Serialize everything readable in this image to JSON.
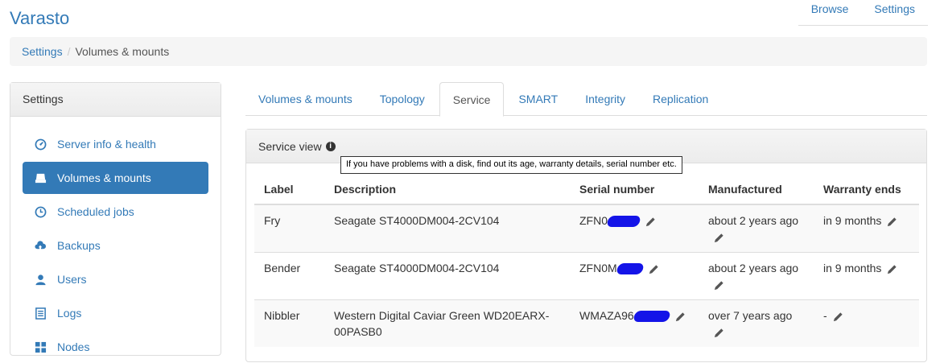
{
  "app": {
    "title": "Varasto"
  },
  "topnav": {
    "items": [
      "Browse",
      "Settings"
    ]
  },
  "breadcrumb": {
    "items": [
      "Settings",
      "Volumes & mounts"
    ]
  },
  "sidebar": {
    "title": "Settings",
    "items": [
      {
        "label": "Server info & health",
        "icon": "dashboard-icon"
      },
      {
        "label": "Volumes & mounts",
        "icon": "hdd-icon",
        "active": true
      },
      {
        "label": "Scheduled jobs",
        "icon": "clock-icon"
      },
      {
        "label": "Backups",
        "icon": "cloud-upload-icon"
      },
      {
        "label": "Users",
        "icon": "user-icon"
      },
      {
        "label": "Logs",
        "icon": "list-icon"
      },
      {
        "label": "Nodes",
        "icon": "grid-icon"
      }
    ]
  },
  "tabs": [
    "Volumes & mounts",
    "Topology",
    "Service",
    "SMART",
    "Integrity",
    "Replication"
  ],
  "active_tab": "Service",
  "panel": {
    "title": "Service view",
    "tooltip": "If you have problems with a disk, find out its age, warranty details, serial number etc."
  },
  "table": {
    "headers": [
      "Label",
      "Description",
      "Serial number",
      "Manufactured",
      "Warranty ends"
    ],
    "rows": [
      {
        "label": "Fry",
        "description": "Seagate ST4000DM004-2CV104",
        "serial": "ZFN0",
        "manufactured": "about 2 years ago",
        "warranty": "in 9 months"
      },
      {
        "label": "Bender",
        "description": "Seagate ST4000DM004-2CV104",
        "serial": "ZFN0M",
        "manufactured": "about 2 years ago",
        "warranty": "in 9 months"
      },
      {
        "label": "Nibbler",
        "description": "Western Digital Caviar Green WD20EARX-00PASB0",
        "serial": "WMAZA96",
        "manufactured": "over 7 years ago",
        "warranty": "-"
      }
    ]
  },
  "colors": {
    "link": "#337ab7",
    "active_bg": "#337ab7",
    "redaction": "#1414e8"
  }
}
